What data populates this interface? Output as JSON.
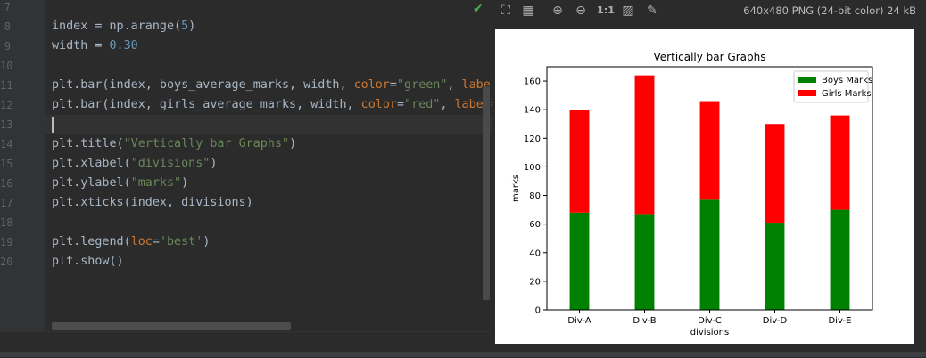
{
  "editor": {
    "lines": [
      {
        "num": "7",
        "tokens": []
      },
      {
        "num": "8",
        "tokens": [
          {
            "t": "index = np.arange(",
            "c": "def"
          },
          {
            "t": "5",
            "c": "num"
          },
          {
            "t": ")",
            "c": "def"
          }
        ]
      },
      {
        "num": "9",
        "tokens": [
          {
            "t": "width = ",
            "c": "def"
          },
          {
            "t": "0.30",
            "c": "num"
          }
        ]
      },
      {
        "num": "10",
        "tokens": []
      },
      {
        "num": "11",
        "tokens": [
          {
            "t": "plt.bar(index, boys_average_marks, width, ",
            "c": "def"
          },
          {
            "t": "color",
            "c": "kw"
          },
          {
            "t": "=",
            "c": "def"
          },
          {
            "t": "\"green\"",
            "c": "str"
          },
          {
            "t": ", ",
            "c": "def"
          },
          {
            "t": "label",
            "c": "kw"
          }
        ]
      },
      {
        "num": "12",
        "tokens": [
          {
            "t": "plt.bar(index, girls_average_marks, width, ",
            "c": "def"
          },
          {
            "t": "color",
            "c": "kw"
          },
          {
            "t": "=",
            "c": "def"
          },
          {
            "t": "\"red\"",
            "c": "str"
          },
          {
            "t": ", ",
            "c": "def"
          },
          {
            "t": "label=",
            "c": "kw"
          }
        ]
      },
      {
        "num": "13",
        "tokens": []
      },
      {
        "num": "14",
        "tokens": [
          {
            "t": "plt.title(",
            "c": "def"
          },
          {
            "t": "\"Vertically bar Graphs\"",
            "c": "str"
          },
          {
            "t": ")",
            "c": "def"
          }
        ]
      },
      {
        "num": "15",
        "tokens": [
          {
            "t": "plt.xlabel(",
            "c": "def"
          },
          {
            "t": "\"divisions\"",
            "c": "str"
          },
          {
            "t": ")",
            "c": "def"
          }
        ]
      },
      {
        "num": "16",
        "tokens": [
          {
            "t": "plt.ylabel(",
            "c": "def"
          },
          {
            "t": "\"marks\"",
            "c": "str"
          },
          {
            "t": ")",
            "c": "def"
          }
        ]
      },
      {
        "num": "17",
        "tokens": [
          {
            "t": "plt.xticks(index, divisions)",
            "c": "def"
          }
        ]
      },
      {
        "num": "18",
        "tokens": []
      },
      {
        "num": "19",
        "tokens": [
          {
            "t": "plt.legend(",
            "c": "def"
          },
          {
            "t": "loc",
            "c": "kw"
          },
          {
            "t": "=",
            "c": "def"
          },
          {
            "t": "'best'",
            "c": "str"
          },
          {
            "t": ")",
            "c": "def"
          }
        ]
      },
      {
        "num": "20",
        "tokens": [
          {
            "t": "plt.show()",
            "c": "def"
          }
        ]
      }
    ],
    "check_mark": "✔"
  },
  "viewer": {
    "info": "640x480 PNG (24-bit color) 24 kB",
    "tools": [
      {
        "name": "fit-screen-icon",
        "glyph": "⛶"
      },
      {
        "name": "grid-icon",
        "glyph": "▦"
      },
      {
        "name": "zoom-in-icon",
        "glyph": "⊕"
      },
      {
        "name": "zoom-out-icon",
        "glyph": "⊖"
      },
      {
        "name": "actual-size-icon",
        "glyph": "1:1"
      },
      {
        "name": "background-icon",
        "glyph": "▨"
      },
      {
        "name": "color-picker-icon",
        "glyph": "✎"
      }
    ]
  },
  "chart_data": {
    "type": "bar",
    "stacked": true,
    "title": "Vertically bar Graphs",
    "xlabel": "divisions",
    "ylabel": "marks",
    "categories": [
      "Div-A",
      "Div-B",
      "Div-C",
      "Div-D",
      "Div-E"
    ],
    "series": [
      {
        "name": "Boys Marks",
        "color": "#008000",
        "values": [
          68,
          67,
          77,
          61,
          70
        ]
      },
      {
        "name": "Girls Marks",
        "color": "#ff0000",
        "values": [
          72,
          97,
          69,
          69,
          66
        ]
      }
    ],
    "ylim": [
      0,
      170
    ],
    "yticks": [
      0,
      20,
      40,
      60,
      80,
      100,
      120,
      140,
      160
    ],
    "legend": "top-right",
    "grid": false
  }
}
